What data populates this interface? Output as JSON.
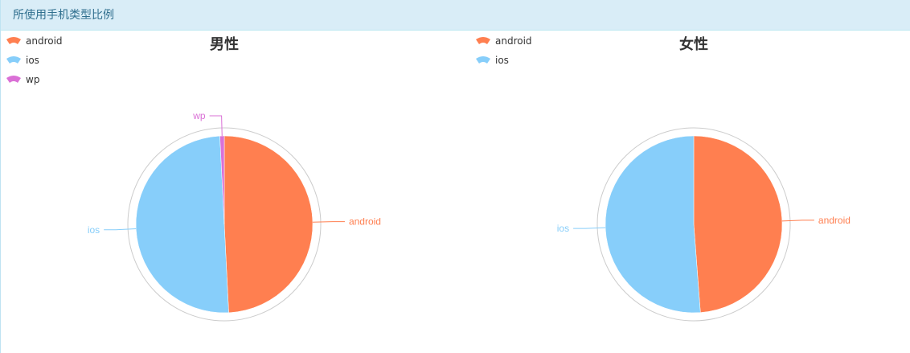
{
  "panel": {
    "title": "所使用手机类型比例"
  },
  "colors": {
    "android": "#ff7f50",
    "ios": "#87cefa",
    "wp": "#da70d6"
  },
  "chart_data": [
    {
      "type": "pie",
      "title": "男性",
      "legend": [
        "android",
        "ios",
        "wp"
      ],
      "legend_position": "top-left",
      "slices": [
        {
          "name": "android",
          "value": 49.2,
          "color": "#ff7f50"
        },
        {
          "name": "ios",
          "value": 50.0,
          "color": "#87cefa"
        },
        {
          "name": "wp",
          "value": 0.8,
          "color": "#da70d6"
        }
      ]
    },
    {
      "type": "pie",
      "title": "女性",
      "legend": [
        "android",
        "ios"
      ],
      "legend_position": "top-left",
      "slices": [
        {
          "name": "android",
          "value": 48.8,
          "color": "#ff7f50"
        },
        {
          "name": "ios",
          "value": 51.2,
          "color": "#87cefa"
        }
      ]
    }
  ]
}
